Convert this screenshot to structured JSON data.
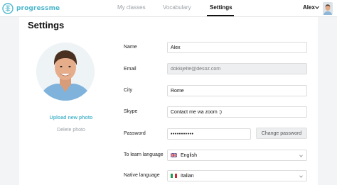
{
  "app": {
    "name": "progressme",
    "accent": "#4fb7cc"
  },
  "nav": {
    "items": [
      {
        "label": "My classes",
        "active": false
      },
      {
        "label": "Vocabulary",
        "active": false
      },
      {
        "label": "Settings",
        "active": true
      }
    ]
  },
  "user": {
    "name": "Alex"
  },
  "page": {
    "title": "Settings"
  },
  "photo": {
    "upload_label": "Upload new photo",
    "delete_label": "Delete photo"
  },
  "form": {
    "name": {
      "label": "Name",
      "value": "Alex"
    },
    "email": {
      "label": "Email",
      "value": "dokkijelte@desoz.com"
    },
    "city": {
      "label": "City",
      "value": "Rome"
    },
    "skype": {
      "label": "Skype",
      "value": "Contact me via zoom :)"
    },
    "password": {
      "label": "Password",
      "value": "•••••••••••",
      "button_label": "Change password"
    },
    "learn_language": {
      "label": "To learn language",
      "value": "English",
      "flag": "uk-flag-icon"
    },
    "native_language": {
      "label": "Native language",
      "value": "Italian",
      "flag": "italy-flag-icon"
    }
  }
}
